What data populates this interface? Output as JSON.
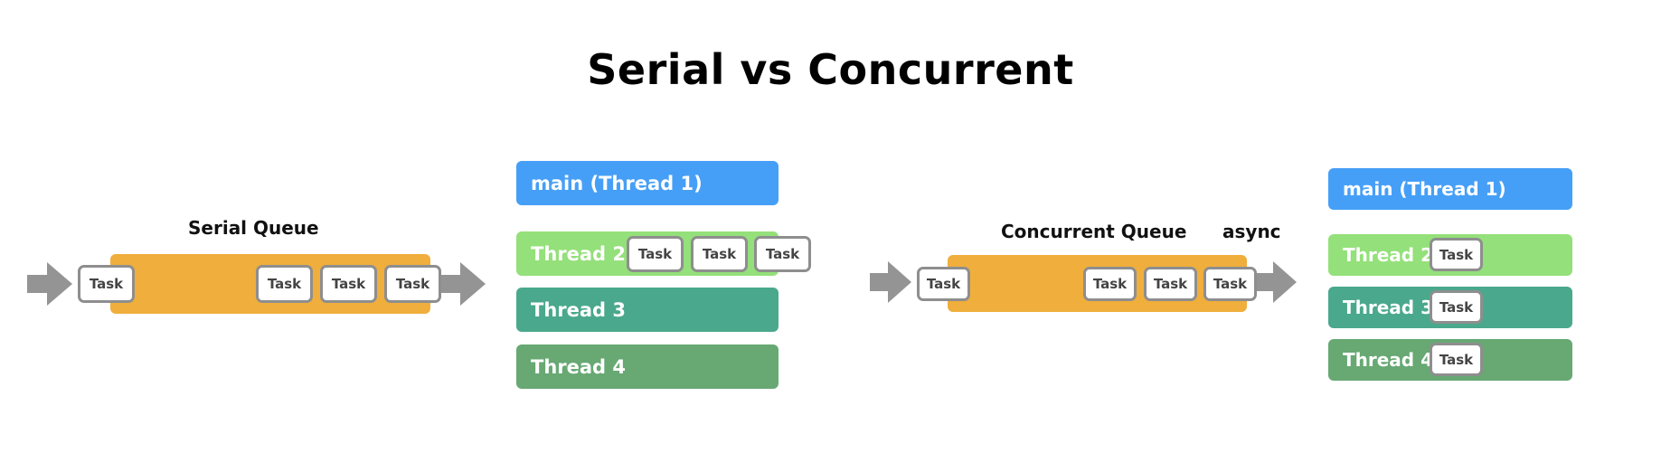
{
  "title": "Serial vs Concurrent",
  "colors": {
    "queue": "#f0ae3c",
    "arrow": "#949494",
    "task_border": "#8e8e8e",
    "main_thread": "#469ff7",
    "thread_2": "#94e07a",
    "thread_3": "#4aa88c",
    "thread_4": "#67a873"
  },
  "serial": {
    "queue_label": "Serial Queue",
    "queue_tasks": [
      "Task",
      "Task",
      "Task",
      "Task"
    ],
    "threads": [
      {
        "label": "main (Thread 1)",
        "tasks": []
      },
      {
        "label": "Thread 2",
        "tasks": [
          "Task",
          "Task",
          "Task"
        ]
      },
      {
        "label": "Thread 3",
        "tasks": []
      },
      {
        "label": "Thread 4",
        "tasks": []
      }
    ]
  },
  "concurrent": {
    "queue_label": "Concurrent Queue",
    "mode_label": "async",
    "queue_tasks": [
      "Task",
      "Task",
      "Task",
      "Task"
    ],
    "threads": [
      {
        "label": "main (Thread 1)",
        "tasks": []
      },
      {
        "label": "Thread 2",
        "tasks": [
          "Task"
        ]
      },
      {
        "label": "Thread 3",
        "tasks": [
          "Task"
        ]
      },
      {
        "label": "Thread 4",
        "tasks": [
          "Task"
        ]
      }
    ]
  }
}
